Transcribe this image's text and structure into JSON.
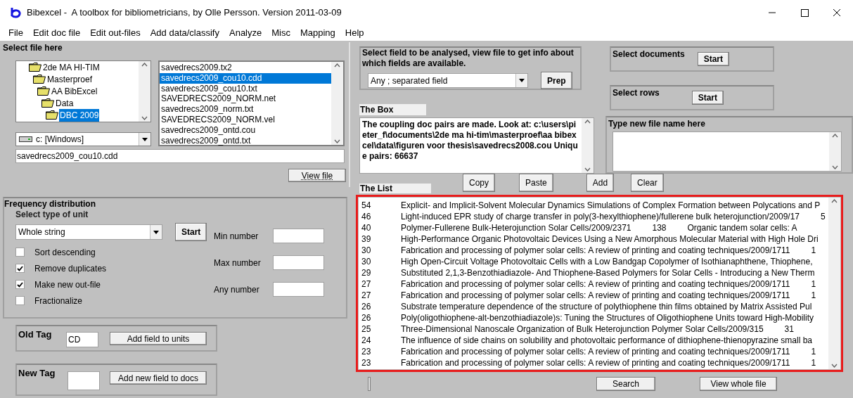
{
  "window": {
    "title": "Bibexcel -  A toolbox for bibliometricians, by Olle Persson. Version 2011-03-09"
  },
  "menu": [
    "File",
    "Edit doc file",
    "Edit out-files",
    "Add data/classify",
    "Analyze",
    "Misc",
    "Mapping",
    "Help"
  ],
  "file_panel": {
    "title": "Select file here",
    "folders": [
      {
        "label": "2de MA HI-TIM",
        "selected": false,
        "children": [
          {
            "label": "Masterproef",
            "selected": false,
            "children": [
              {
                "label": "AA BibExcel",
                "selected": false,
                "children": [
                  {
                    "label": "Data",
                    "selected": false,
                    "children": [
                      {
                        "label": "DBC 2009",
                        "selected": true
                      }
                    ]
                  }
                ]
              }
            ]
          }
        ]
      }
    ],
    "drive": "c: [Windows]",
    "files": [
      {
        "label": "savedrecs2009.tx2",
        "selected": false
      },
      {
        "label": "savedrecs2009_cou10.cdd",
        "selected": true
      },
      {
        "label": "savedrecs2009_cou10.txt",
        "selected": false
      },
      {
        "label": "SAVEDRECS2009_NORM.net",
        "selected": false
      },
      {
        "label": "savedrecs2009_norm.txt",
        "selected": false
      },
      {
        "label": "SAVEDRECS2009_NORM.vel",
        "selected": false
      },
      {
        "label": "savedrecs2009_ontd.cou",
        "selected": false
      },
      {
        "label": "savedrecs2009_ontd.txt",
        "selected": false
      }
    ],
    "filename": "savedrecs2009_cou10.cdd",
    "view_button": "View file"
  },
  "frequency": {
    "title": "Frequency distribution",
    "unit_label": "Select type of unit",
    "unit": "Whole string",
    "start": "Start",
    "options": [
      {
        "label": "Sort descending",
        "checked": false
      },
      {
        "label": "Remove duplicates",
        "checked": true
      },
      {
        "label": "Make new out-file",
        "checked": true
      },
      {
        "label": "Fractionalize",
        "checked": false
      }
    ],
    "numbers": [
      "Min number",
      "Max number",
      "Any number"
    ]
  },
  "old_tag": {
    "label": "Old Tag",
    "value": "CD",
    "button": "Add field to units"
  },
  "new_tag": {
    "label": "New Tag",
    "button": "Add new field to docs"
  },
  "field_panel": {
    "title": "Select field to be analysed, view file to get info about which fields are available.",
    "field": "Any ; separated field",
    "button": "Prep"
  },
  "select_documents": {
    "title": "Select documents",
    "button": "Start"
  },
  "select_rows": {
    "title": "Select rows",
    "button": "Start"
  },
  "box": {
    "title": "The Box",
    "text": "The coupling doc pairs are made. Look at: c:\\users\\pieter_f\\documents\\2de ma hi-tim\\masterproef\\aa bibexcel\\data\\figuren voor thesis\\savedrecs2008.cou Unique pairs: 66637"
  },
  "new_file": {
    "title": "Type new file name here"
  },
  "list_buttons": [
    "Copy",
    "Paste",
    "Add",
    "Clear"
  ],
  "list": {
    "title": "The List",
    "rows": [
      {
        "count": "54",
        "text": "Explicit- and Implicit-Solvent Molecular Dynamics Simulations of Complex Formation between Polycations and P",
        "more": []
      },
      {
        "count": "46",
        "text": "Light-induced EPR study of charge transfer in poly(3-hexylthiophene)/fullerene bulk heterojunction/2009/17",
        "more": [
          "5"
        ]
      },
      {
        "count": "40",
        "text": "Polymer-Fullerene Bulk-Heterojunction Solar Cells/2009/2371",
        "more": [
          "138",
          "Organic tandem solar cells: A"
        ]
      },
      {
        "count": "39",
        "text": "High-Performance Organic Photovoltaic Devices Using a New Amorphous Molecular Material with High Hole Dri",
        "more": []
      },
      {
        "count": "30",
        "text": "Fabrication and processing of polymer solar cells: A review of printing and coating techniques/2009/1711",
        "more": [
          "1"
        ]
      },
      {
        "count": "30",
        "text": "High Open-Circuit Voltage Photovoltaic Cells with a Low Bandgap Copolymer of Isothianaphthene, Thiophene,",
        "more": []
      },
      {
        "count": "29",
        "text": "Substituted 2,1,3-Benzothiadiazole- And Thiophene-Based Polymers for Solar Cells - Introducing a New Therm",
        "more": []
      },
      {
        "count": "27",
        "text": "Fabrication and processing of polymer solar cells: A review of printing and coating techniques/2009/1711",
        "more": [
          "1"
        ]
      },
      {
        "count": "27",
        "text": "Fabrication and processing of polymer solar cells: A review of printing and coating techniques/2009/1711",
        "more": [
          "1"
        ]
      },
      {
        "count": "26",
        "text": "Substrate temperature dependence of the structure of polythiophene thin films obtained by Matrix Assisted Pul",
        "more": []
      },
      {
        "count": "26",
        "text": "Poly(oligothiophene-alt-benzothiadiazole)s: Tuning the Structures of Oligothiophene Units toward High-Mobility",
        "more": []
      },
      {
        "count": "25",
        "text": "Three-Dimensional Nanoscale Organization of Bulk Heterojunction Polymer Solar Cells/2009/315",
        "more": [
          "31"
        ]
      },
      {
        "count": "24",
        "text": "The influence of side chains on solubility and photovoltaic performance of dithiophene-thienopyrazine small ba",
        "more": []
      },
      {
        "count": "23",
        "text": "Fabrication and processing of polymer solar cells: A review of printing and coating techniques/2009/1711",
        "more": [
          "1"
        ]
      },
      {
        "count": "23",
        "text": "Fabrication and processing of polymer solar cells: A review of printing and coating techniques/2009/1711",
        "more": [
          "1"
        ]
      }
    ]
  },
  "bottom_buttons": [
    "Search",
    "View whole file"
  ]
}
